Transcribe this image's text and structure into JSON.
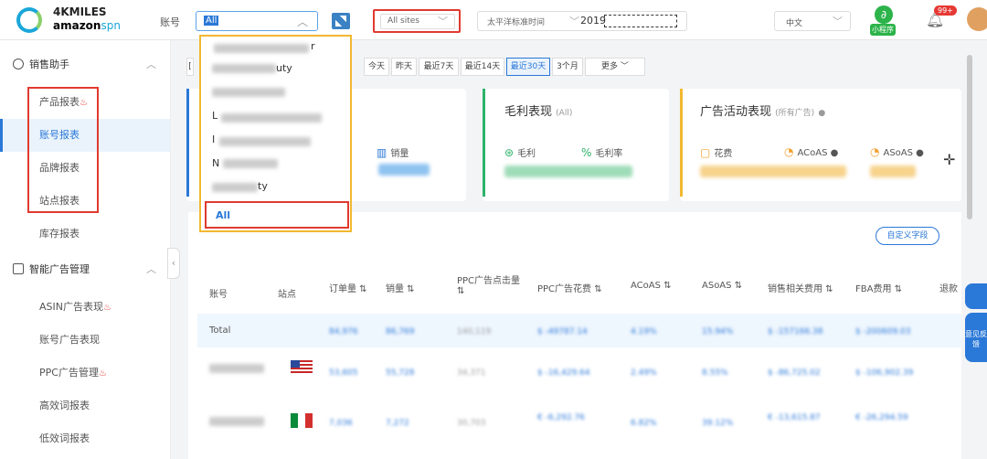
{
  "topbar": {
    "logo_line1": "4KMILES",
    "logo_line2a": "amazon",
    "logo_line2b": "spn",
    "account_label": "账号",
    "account_value": "All",
    "site_value": "All sites",
    "timezone": "太平洋标准时间",
    "date_prefix": "2019",
    "language": "中文",
    "mini_program": "小程序",
    "notif_count": "99+"
  },
  "sidebar": {
    "group1": "销售助手",
    "items1": [
      "产品报表",
      "账号报表",
      "品牌报表",
      "站点报表",
      "库存报表"
    ],
    "group2": "智能广告管理",
    "items2": [
      "ASIN广告表现",
      "账号广告表现",
      "PPC广告管理",
      "高效词报表",
      "低效词报表"
    ]
  },
  "dateButtons": [
    "今天",
    "昨天",
    "最近7天",
    "最近14天",
    "最近30天",
    "3个月",
    "更多"
  ],
  "cards": {
    "sales_metric": "销量",
    "profit_title": "毛利表现",
    "profit_sub": "(All)",
    "profit_m1": "毛利",
    "profit_m2": "毛利率",
    "ad_title": "广告活动表现",
    "ad_sub": "(所有广告)",
    "ad_m1": "花费",
    "ad_m2": "ACoAS",
    "ad_m3": "ASoAS"
  },
  "custom_fields": "自定义字段",
  "table": {
    "headers": [
      "账号",
      "站点",
      "订单量",
      "销量",
      "PPC广告点击量",
      "PPC广告花费",
      "ACoAS",
      "ASoAS",
      "销售相关费用",
      "FBA费用",
      "退款"
    ],
    "total_label": "Total"
  },
  "dropdown": {
    "items": [
      "r",
      "uty",
      "",
      "L",
      "I",
      "N",
      "ty"
    ],
    "all_label": "All"
  },
  "side_float": "意见反馈"
}
